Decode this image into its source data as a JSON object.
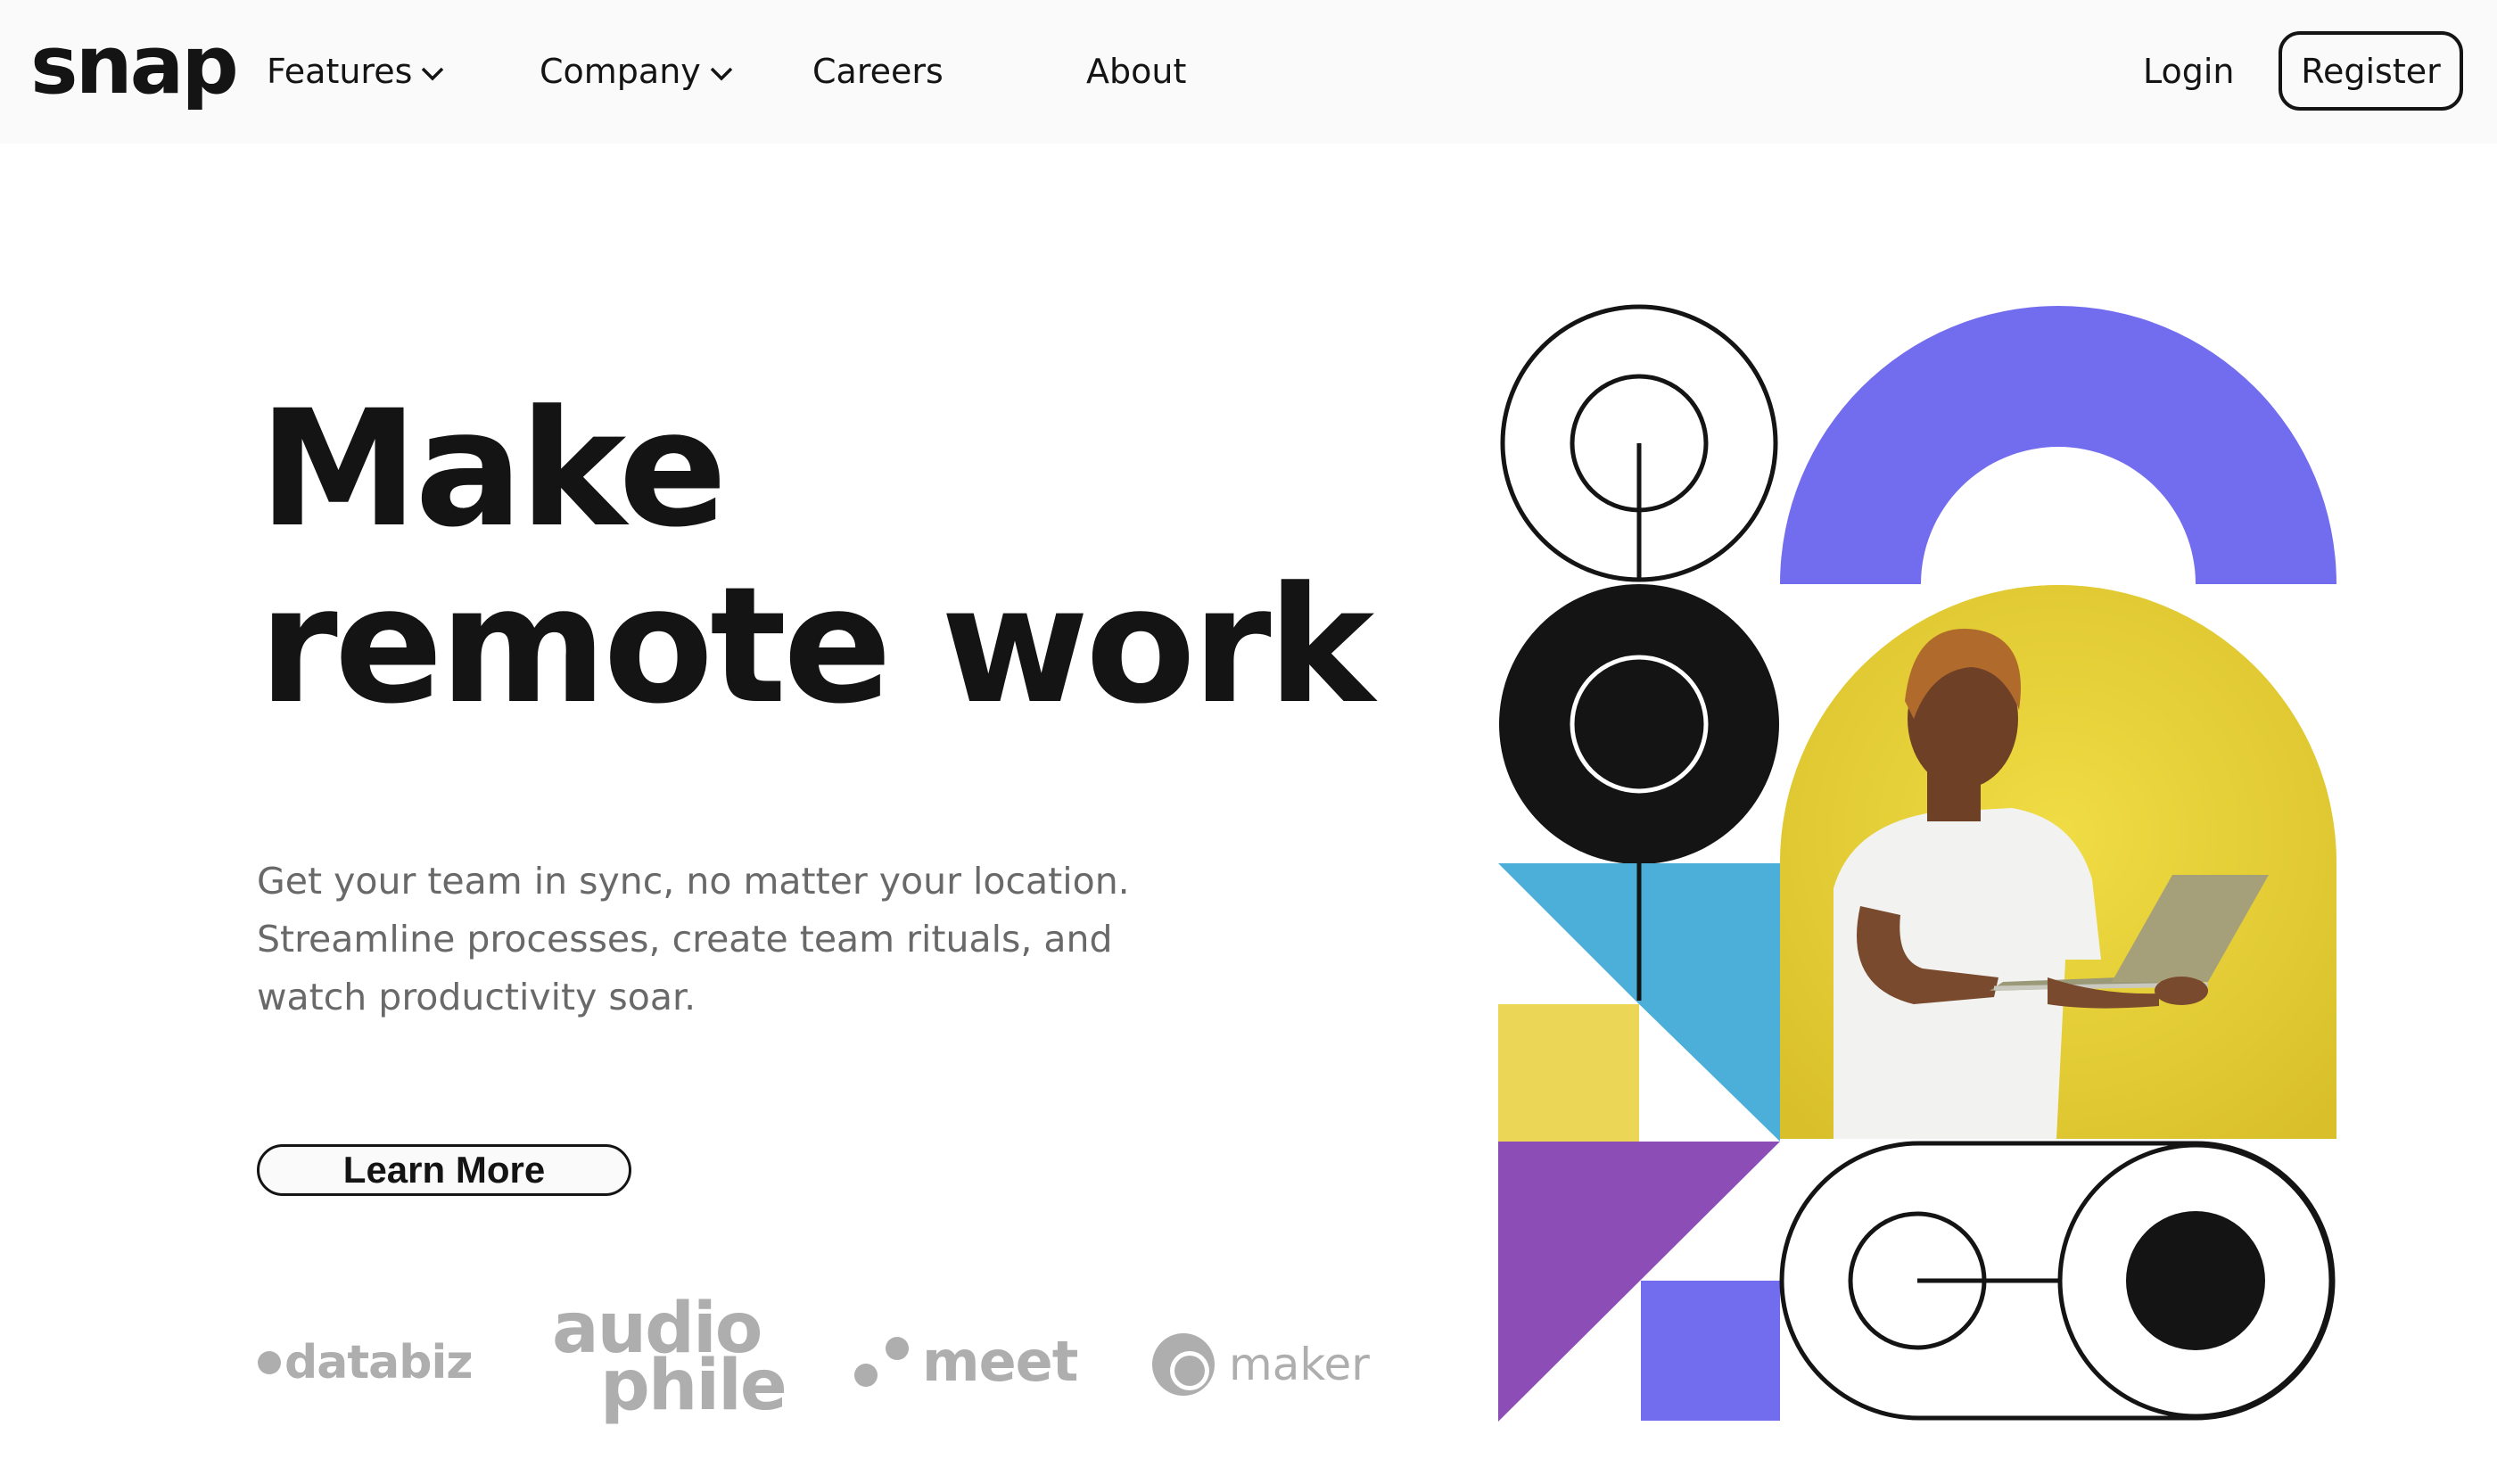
{
  "header": {
    "logo": "snap",
    "nav": {
      "features": "Features",
      "company": "Company",
      "careers": "Careers",
      "about": "About"
    },
    "login": "Login",
    "register": "Register"
  },
  "hero": {
    "title_line1": "Make",
    "title_line2": "remote work",
    "description": "Get your team in sync, no matter your location. Streamline processes, create team rituals, and watch productivity soar.",
    "cta": "Learn More"
  },
  "clients": {
    "databiz": "databiz",
    "audiophile_line1": "audio",
    "audiophile_line2": "phile",
    "meet": "meet",
    "maker": "maker"
  },
  "colors": {
    "text": "#141414",
    "muted": "#696969",
    "purple": "#726cee",
    "violet": "#8c4db7",
    "yellow": "#ecd655",
    "blue": "#4bafd9"
  }
}
